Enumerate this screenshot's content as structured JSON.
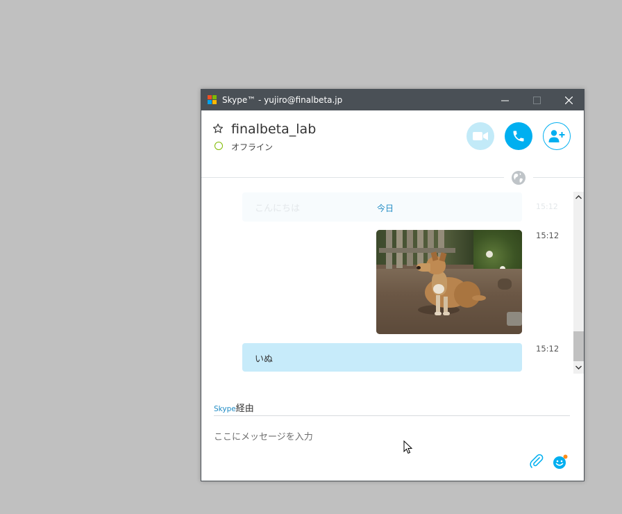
{
  "window": {
    "title": "Skype™ - yujiro@finalbeta.jp",
    "controls": {
      "minimize": "minimize-icon",
      "maximize": "maximize-icon",
      "close": "close-icon"
    }
  },
  "contact": {
    "name": "finalbeta_lab",
    "status": "オフライン",
    "status_color": "#7fba00"
  },
  "actions": {
    "video_icon": "video-camera-icon",
    "call_icon": "phone-icon",
    "add_contact_icon": "add-person-icon"
  },
  "conversation": {
    "date_separator": "今日",
    "faded_message": {
      "text": "こんにちは",
      "time": "15:12"
    },
    "messages": [
      {
        "type": "image",
        "description_icon": "dog-photo",
        "time": "15:12"
      },
      {
        "type": "text",
        "text": "いぬ",
        "time": "15:12"
      }
    ]
  },
  "composer": {
    "via_prefix": "Skype",
    "via_suffix": "経由",
    "placeholder": "ここにメッセージを入力",
    "attach_icon": "paperclip-icon",
    "emoji_icon": "emoticon-icon"
  },
  "colors": {
    "accent": "#00aff0",
    "link_blue": "#1f8bc4",
    "titlebar": "#4a5056",
    "bubble": "#c7ebfa",
    "desktop": "#c0c0c0"
  }
}
